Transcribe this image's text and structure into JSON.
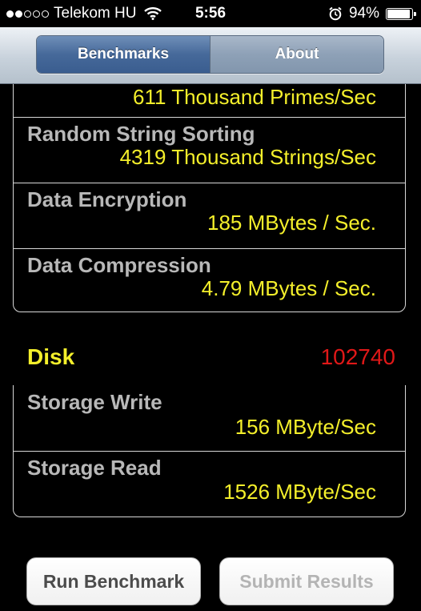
{
  "status_bar": {
    "carrier": "Telekom HU",
    "time": "5:56",
    "battery": "94%",
    "battery_level": 0.94,
    "signal_bars": 2
  },
  "nav": {
    "tabs": [
      {
        "label": "Benchmarks",
        "active": true
      },
      {
        "label": "About",
        "active": false
      }
    ]
  },
  "cpu_group": {
    "partial_value": "611 Thousand Primes/Sec",
    "rows": [
      {
        "label": "Random String Sorting",
        "value": "4319 Thousand Strings/Sec"
      },
      {
        "label": "Data Encryption",
        "value": "185 MBytes / Sec."
      },
      {
        "label": "Data Compression",
        "value": "4.79 MBytes / Sec."
      }
    ]
  },
  "disk": {
    "title": "Disk",
    "score": "102740",
    "rows": [
      {
        "label": "Storage Write",
        "value": "156 MByte/Sec"
      },
      {
        "label": "Storage Read",
        "value": "1526 MByte/Sec"
      }
    ]
  },
  "buttons": {
    "run": "Run Benchmark",
    "submit": "Submit Results"
  },
  "colors": {
    "value_yellow": "#f4ef2b",
    "score_red": "#e01818",
    "label_gray": "#b8b8b8",
    "nav_active": "#46699a"
  }
}
